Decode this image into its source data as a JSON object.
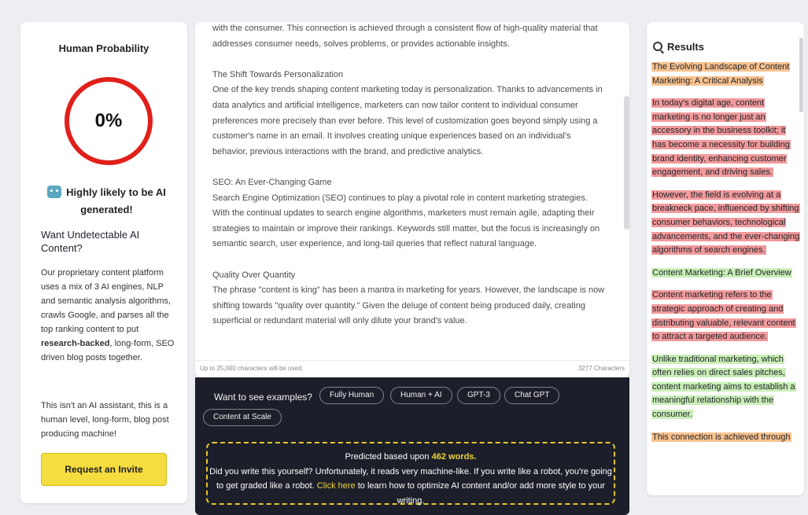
{
  "left": {
    "title": "Human Probability",
    "score": "0%",
    "verdict": "Highly likely to be AI generated!",
    "promo_heading": "Want Undetectable AI Content?",
    "promo_text_before": "Our proprietary content platform uses a mix of 3 AI engines, NLP and semantic analysis algorithms, crawls Google, and parses all the top ranking content to put ",
    "promo_text_bold": "research-backed",
    "promo_text_after": ", long-form, SEO driven blog posts together.",
    "promo_text2": "This isn't an AI assistant, this is a human level, long-form, blog post producing machine!",
    "invite_button": "Request an Invite"
  },
  "editor": {
    "paragraphs": [
      "with the consumer. This connection is achieved through a consistent flow of high-quality material that addresses consumer needs, solves problems, or provides actionable insights.",
      "The Shift Towards Personalization",
      "One of the key trends shaping content marketing today is personalization. Thanks to advancements in data analytics and artificial intelligence, marketers can now tailor content to individual consumer preferences more precisely than ever before. This level of customization goes beyond simply using a customer's name in an email. It involves creating unique experiences based on an individual's behavior, previous interactions with the brand, and predictive analytics.",
      "SEO: An Ever-Changing Game",
      "Search Engine Optimization (SEO) continues to play a pivotal role in content marketing strategies. With the continual updates to search engine algorithms, marketers must remain agile, adapting their strategies to maintain or improve their rankings. Keywords still matter, but the focus is increasingly on semantic search, user experience, and long-tail queries that reflect natural language.",
      "Quality Over Quantity",
      "The phrase \"content is king\" has been a mantra in marketing for years. However, the landscape is now shifting towards \"quality over quantity.\" Given the deluge of content being produced daily, creating superficial or redundant material will only dilute your brand's value."
    ],
    "limit_note": "Up to 25,000 characters will be used.",
    "char_count": "3277 Characters"
  },
  "examples": {
    "label": "Want to see examples?",
    "chips": [
      "Fully Human",
      "Human + AI",
      "GPT-3",
      "Chat GPT",
      "Content at Scale"
    ]
  },
  "prediction": {
    "prefix": "Predicted based upon ",
    "words": "462 words.",
    "line2": "Did you write this yourself? Unfortunately, it reads very machine-like. If you write like a robot, you're going to get graded like a robot. ",
    "link": "Click here",
    "line3": " to learn how to optimize AI content and/or add more style to your writing."
  },
  "results": {
    "title": "Results",
    "segments": [
      {
        "text": "The Evolving Landscape of Content Marketing: A Critical Analysis",
        "color": "#f9c28f"
      },
      {
        "text": "In today's digital age, content marketing is no longer just an accessory in the business toolkit; it has become a necessity for building brand identity, enhancing customer engagement, and driving sales.",
        "color": "#f29a9c"
      },
      {
        "text": "However, the field is evolving at a breakneck pace, influenced by shifting consumer behaviors, technological advancements, and the ever-changing algorithms of search engines.",
        "color": "#f29a9c"
      },
      {
        "text": "Content Marketing: A Brief Overview",
        "color": "#c9eeb7"
      },
      {
        "text": "Content marketing refers to the strategic approach of creating and distributing valuable, relevant content to attract a targeted audience.",
        "color": "#f29a9c"
      },
      {
        "text": "Unlike traditional marketing, which often relies on direct sales pitches, content marketing aims to establish a meaningful relationship with the consumer.",
        "color": "#c9eeb7"
      },
      {
        "text": "This connection is achieved through",
        "color": "#f9c28f"
      }
    ]
  }
}
